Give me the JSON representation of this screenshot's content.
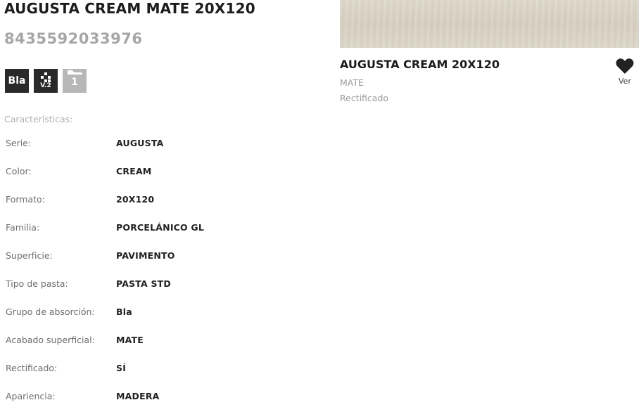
{
  "product": {
    "title": "AUGUSTA CREAM MATE 20X120",
    "ean": "8435592033976",
    "badges": {
      "absorption": "Bla",
      "variation": "V.2",
      "traffic": "1"
    }
  },
  "specs": {
    "section_label": "Características:",
    "rows": [
      {
        "key": "Serie:",
        "value": "AUGUSTA"
      },
      {
        "key": "Color:",
        "value": "CREAM"
      },
      {
        "key": "Formato:",
        "value": "20X120"
      },
      {
        "key": "Familia:",
        "value": "PORCELÁNICO GL"
      },
      {
        "key": "Superficie:",
        "value": "PAVIMENTO"
      },
      {
        "key": "Tipo de pasta:",
        "value": "PASTA STD"
      },
      {
        "key": "Grupo de absorción:",
        "value": "Bla"
      },
      {
        "key": "Acabado superficial:",
        "value": "MATE"
      },
      {
        "key": "Rectificado:",
        "value": "SÍ"
      },
      {
        "key": "Apariencia:",
        "value": "MADERA"
      }
    ]
  },
  "related": {
    "title": "AUGUSTA CREAM 20X120",
    "finish": "MATE",
    "rectified": "Rectificado",
    "favorite_label": "Ver",
    "icon": "heart-icon"
  },
  "colors": {
    "title": "#1c1c1c",
    "ean": "#a6a6a6",
    "badge_dark": "#2a2a2a",
    "badge_light": "#b7b7b7",
    "thumb": "#d9d3c6"
  }
}
